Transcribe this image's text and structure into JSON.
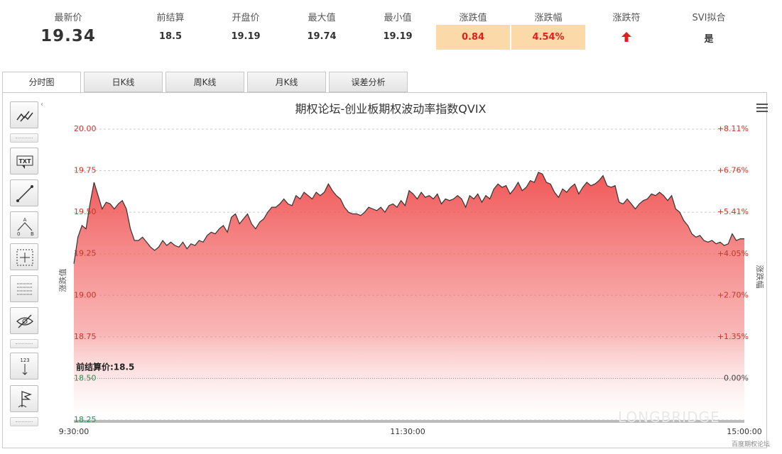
{
  "summary": {
    "latest_label": "最新价",
    "latest": "19.34",
    "prev_settle_label": "前结算",
    "prev_settle": "18.5",
    "open_label": "开盘价",
    "open": "19.19",
    "high_label": "最大值",
    "high": "19.74",
    "low_label": "最小值",
    "low": "19.19",
    "change_label": "涨跌值",
    "change": "0.84",
    "change_pct_label": "涨跌幅",
    "change_pct": "4.54%",
    "direction_label": "涨跌符",
    "direction_icon": "up-arrow-icon",
    "svi_label": "SVI拟合",
    "svi": "是",
    "highlight_color": "#fcd9a8",
    "up_color": "#e41e1e"
  },
  "tabs": [
    "分时图",
    "日K线",
    "周K线",
    "月K线",
    "误差分析"
  ],
  "toolbar": [
    "trend-line-icon",
    "text-icon",
    "line-icon",
    "abc-pattern-icon",
    "crosshair-icon",
    "grid-lines-icon",
    "hide-eye-icon",
    "counter-icon",
    "flag-icon"
  ],
  "toolbar_text": {
    "txt": "TXT",
    "a": "A",
    "b": "B",
    "zero": "0",
    "count": "123"
  },
  "watermark": {
    "brand": "LONGBRIDGE",
    "source": "百度期权论坛"
  },
  "chart_data": {
    "type": "area",
    "title": "期权论坛-创业板期权波动率指数QVIX",
    "ylabel": "涨跌值",
    "ylabel_right": "涨跌幅",
    "ylim": [
      18.25,
      20.0
    ],
    "yticks": [
      "20.00",
      "19.75",
      "19.50",
      "19.25",
      "19.00",
      "18.75",
      "18.50",
      "18.25"
    ],
    "yticks_right": [
      "+8.11%",
      "+6.76%",
      "+5.41%",
      "+4.05%",
      "+2.70%",
      "+1.35%",
      "0.00%"
    ],
    "xticks": [
      "9:30:00",
      "11:30:00",
      "15:00:00"
    ],
    "reference": {
      "label": "前结算价:18.5",
      "value": 18.5
    },
    "fill_color": "#ef4444",
    "line_color": "#333333",
    "series": [
      {
        "values": [
          19.19,
          19.35,
          19.42,
          19.4,
          19.55,
          19.68,
          19.6,
          19.52,
          19.56,
          19.55,
          19.52,
          19.55,
          19.57,
          19.52,
          19.4,
          19.33,
          19.33,
          19.35,
          19.32,
          19.29,
          19.27,
          19.29,
          19.33,
          19.3,
          19.32,
          19.3,
          19.29,
          19.32,
          19.28,
          19.31,
          19.3,
          19.33,
          19.32,
          19.36,
          19.38,
          19.37,
          19.4,
          19.42,
          19.38,
          19.47,
          19.49,
          19.43,
          19.46,
          19.49,
          19.43,
          19.4,
          19.44,
          19.46,
          19.5,
          19.53,
          19.53,
          19.55,
          19.58,
          19.55,
          19.54,
          19.6,
          19.58,
          19.62,
          19.6,
          19.58,
          19.62,
          19.6,
          19.62,
          19.67,
          19.63,
          19.6,
          19.58,
          19.53,
          19.5,
          19.49,
          19.49,
          19.48,
          19.5,
          19.53,
          19.52,
          19.51,
          19.53,
          19.5,
          19.54,
          19.55,
          19.53,
          19.57,
          19.54,
          19.63,
          19.61,
          19.58,
          19.62,
          19.59,
          19.6,
          19.58,
          19.61,
          19.55,
          19.58,
          19.57,
          19.58,
          19.6,
          19.58,
          19.53,
          19.6,
          19.58,
          19.61,
          19.56,
          19.6,
          19.58,
          19.64,
          19.67,
          19.65,
          19.66,
          19.61,
          19.64,
          19.68,
          19.63,
          19.65,
          19.69,
          19.68,
          19.74,
          19.73,
          19.68,
          19.67,
          19.62,
          19.59,
          19.64,
          19.62,
          19.65,
          19.67,
          19.61,
          19.65,
          19.68,
          19.66,
          19.67,
          19.69,
          19.72,
          19.66,
          19.65,
          19.66,
          19.56,
          19.55,
          19.58,
          19.55,
          19.52,
          19.55,
          19.57,
          19.58,
          19.61,
          19.6,
          19.62,
          19.6,
          19.57,
          19.6,
          19.52,
          19.5,
          19.45,
          19.42,
          19.37,
          19.35,
          19.36,
          19.33,
          19.32,
          19.33,
          19.31,
          19.32,
          19.3,
          19.31,
          19.37,
          19.33,
          19.34,
          19.34
        ]
      }
    ]
  }
}
